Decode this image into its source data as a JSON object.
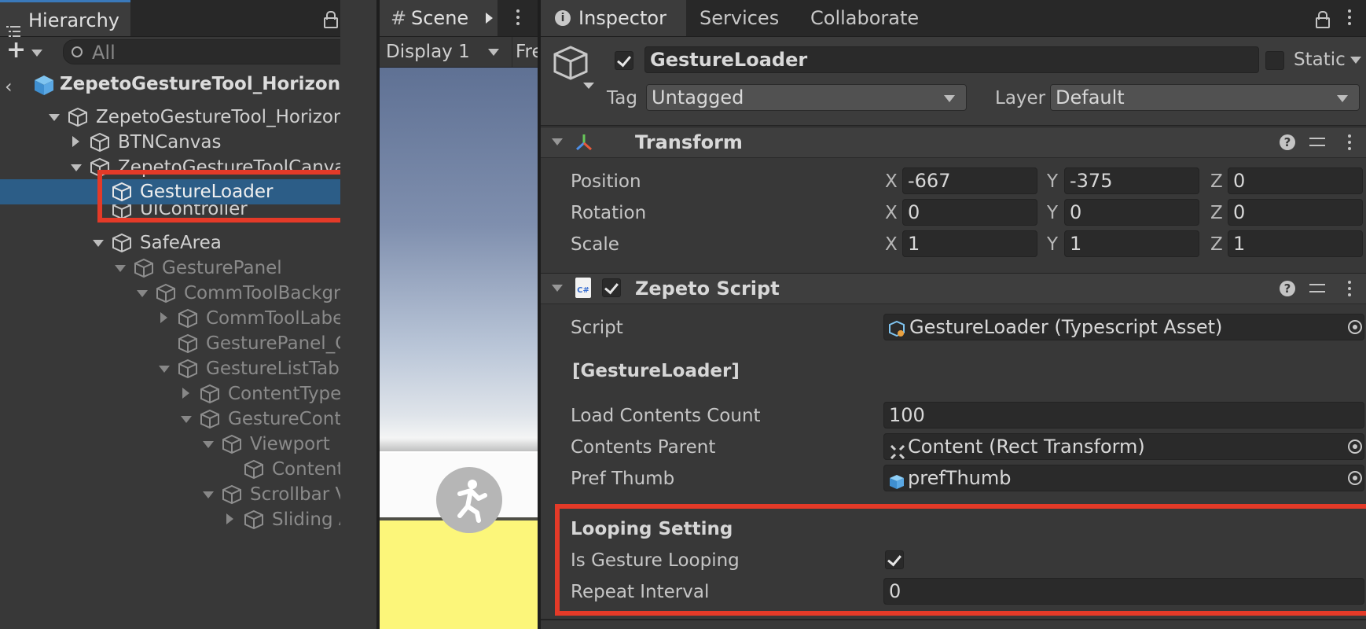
{
  "hierarchy": {
    "tab_label": "Hierarchy",
    "search_placeholder": "All",
    "scene_root": "ZepetoGestureTool_Horizontal",
    "rows": [
      {
        "label": "ZepetoGestureTool_Horizontal"
      },
      {
        "label": "BTNCanvas"
      },
      {
        "label": "ZepetoGestureToolCanvas"
      },
      {
        "label": "GestureLoader"
      },
      {
        "label": "UIController"
      },
      {
        "label": "SafeArea"
      },
      {
        "label": "GesturePanel"
      },
      {
        "label": "CommToolBackgroun"
      },
      {
        "label": "CommToolLabelTa"
      },
      {
        "label": "GesturePanel_Close"
      },
      {
        "label": "GestureListTab"
      },
      {
        "label": "ContentTypeScre"
      },
      {
        "label": "GestureContents"
      },
      {
        "label": "Viewport"
      },
      {
        "label": "Content"
      },
      {
        "label": "Scrollbar Vertic"
      },
      {
        "label": "Sliding Area"
      }
    ]
  },
  "scene": {
    "tab_label": "Scene",
    "display_label": "Display 1",
    "free_label": "Fre"
  },
  "inspector": {
    "tabs": [
      "Inspector",
      "Services",
      "Collaborate"
    ],
    "object_name": "GestureLoader",
    "static_label": "Static",
    "tag_label": "Tag",
    "tag_value": "Untagged",
    "layer_label": "Layer",
    "layer_value": "Default",
    "transform": {
      "title": "Transform",
      "rows": [
        {
          "label": "Position",
          "x": "-667",
          "y": "-375",
          "z": "0"
        },
        {
          "label": "Rotation",
          "x": "0",
          "y": "0",
          "z": "0"
        },
        {
          "label": "Scale",
          "x": "1",
          "y": "1",
          "z": "1"
        }
      ],
      "axis_x": "X",
      "axis_y": "Y",
      "axis_z": "Z"
    },
    "script_component": {
      "title": "Zepeto Script",
      "script_label": "Script",
      "script_value": "GestureLoader (Typescript Asset)",
      "section_header": "[GestureLoader]",
      "load_count_label": "Load Contents Count",
      "load_count_value": "100",
      "contents_parent_label": "Contents Parent",
      "contents_parent_value": "Content (Rect Transform)",
      "pref_thumb_label": "Pref Thumb",
      "pref_thumb_value": "prefThumb",
      "looping_header": "Looping Setting",
      "is_looping_label": "Is Gesture Looping",
      "repeat_interval_label": "Repeat Interval",
      "repeat_interval_value": "0"
    },
    "help_glyph": "?",
    "script_icon_text": "C#"
  },
  "colors": {
    "highlight_box": "#e43a28",
    "selection": "#2c5d87",
    "accent_tab": "#3a79bb"
  }
}
